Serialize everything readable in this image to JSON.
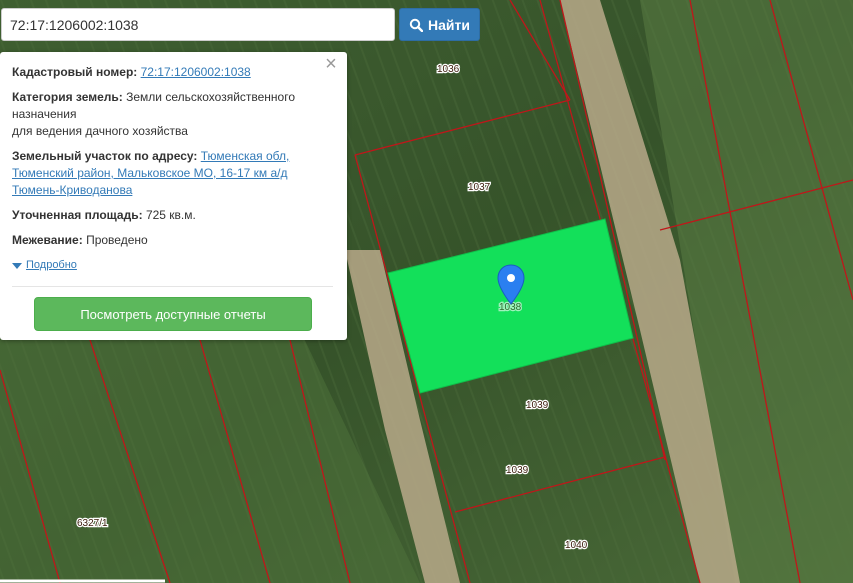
{
  "search": {
    "value": "72:17:1206002:1038",
    "button_label": "Найти"
  },
  "parcel": {
    "cadastral_label": "Кадастровый номер:",
    "cadastral_value": "72:17:1206002:1038",
    "category_label": "Категория земель:",
    "category_value": "Земли сельскохозяйственного назначения",
    "category_use": "для ведения дачного хозяйства",
    "address_label": "Земельный участок по адресу:",
    "address_value": "Тюменская обл, Тюменский район, Мальковское МО, 16-17 км а/д Тюмень-Криводанова",
    "area_label": "Уточненная площадь:",
    "area_value": "725 кв.м.",
    "survey_label": "Межевание:",
    "survey_value": "Проведено",
    "more_label": "Подробно",
    "report_button": "Посмотреть доступные отчеты"
  },
  "map": {
    "parcel_labels": {
      "p1036": "1036",
      "p1037": "1037",
      "p1038": "1038",
      "p1039a": "1039",
      "p1039b": "1039",
      "p1040": "1040",
      "p6327": "6327/1"
    },
    "colors": {
      "selected_parcel": "#13e05a",
      "boundary": "#c0161a",
      "marker": "#2a7ff0",
      "field_dark": "#34502a",
      "field_light": "#5d7d45",
      "road": "#c2b391"
    }
  }
}
